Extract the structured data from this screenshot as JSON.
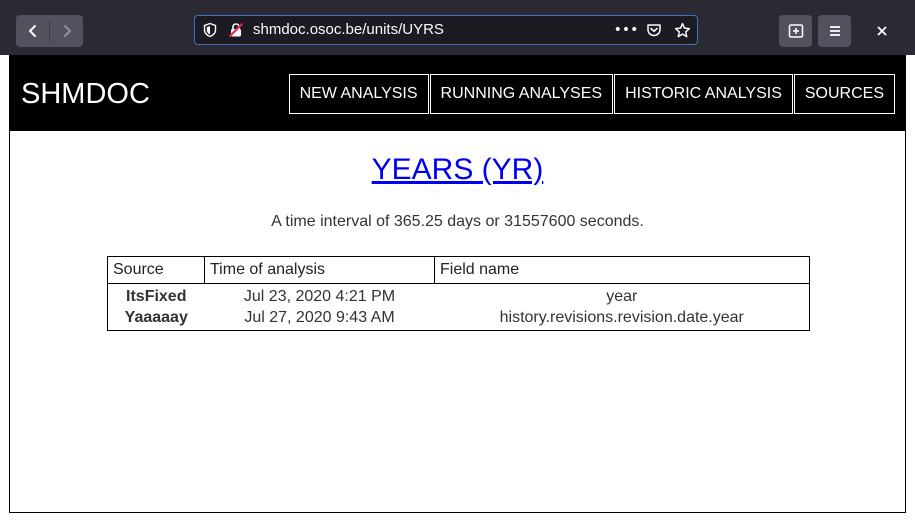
{
  "browser": {
    "url": "shmdoc.osoc.be/units/UYRS",
    "more_glyph": "•••",
    "icons": {
      "back": "back-arrow-icon",
      "forward": "forward-arrow-icon",
      "shield": "tracking-shield-icon",
      "lock": "insecure-lock-icon",
      "pocket": "pocket-icon",
      "bookmark": "star-icon",
      "new_tab": "new-tab-icon",
      "menu": "hamburger-menu-icon",
      "close": "close-icon"
    },
    "accent": "#3f72c4"
  },
  "site": {
    "brand": "SHMDOC",
    "nav": [
      {
        "label": "NEW ANALYSIS"
      },
      {
        "label": "RUNNING ANALYSES"
      },
      {
        "label": "HISTORIC ANALYSIS"
      },
      {
        "label": "SOURCES"
      }
    ]
  },
  "unit": {
    "title": "YEARS (YR)",
    "description": "A time interval of 365.25 days or 31557600 seconds."
  },
  "table": {
    "headers": [
      "Source",
      "Time of analysis",
      "Field name"
    ],
    "rows": [
      {
        "source": "ItsFixed",
        "time": "Jul 23, 2020 4:21 PM",
        "field": "year"
      },
      {
        "source": "Yaaaaay",
        "time": "Jul 27, 2020 9:43 AM",
        "field": "history.revisions.revision.date.year"
      }
    ]
  },
  "colors": {
    "header_bg": "#000000",
    "link": "#0000ee",
    "chrome_bg": "#2b2a33"
  }
}
